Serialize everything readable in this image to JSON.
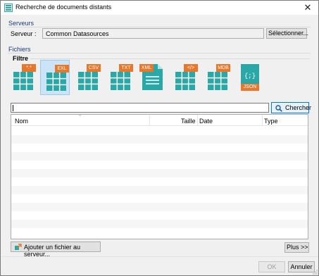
{
  "window": {
    "title": "Recherche de documents distants",
    "close_label": "✕"
  },
  "serveurs": {
    "group_title": "Serveurs",
    "server_label": "Serveur :",
    "server_value": "Common Datasources",
    "select_button": "Sélectionner..."
  },
  "fichiers": {
    "group_title": "Fichiers",
    "filter_label": "Filtre",
    "filters": [
      {
        "badge": "*.*",
        "kind": "table",
        "selected": false
      },
      {
        "badge": "EXL",
        "kind": "table",
        "selected": true
      },
      {
        "badge": "CSV",
        "kind": "table",
        "selected": false
      },
      {
        "badge": "TXT",
        "kind": "table",
        "selected": false
      },
      {
        "badge": "XML",
        "kind": "document",
        "selected": false
      },
      {
        "badge": "</>",
        "kind": "table",
        "selected": false
      },
      {
        "badge": "MDB",
        "kind": "table",
        "selected": false
      },
      {
        "badge": "JSON",
        "kind": "json",
        "selected": false
      }
    ],
    "search": {
      "value": "",
      "button_label": "Chercher"
    },
    "table": {
      "columns": [
        "Nom",
        "Taille",
        "Date",
        "Type"
      ],
      "rows": []
    },
    "add_file_button": "Ajouter un fichier au serveur...",
    "more_button": "Plus >>"
  },
  "footer": {
    "ok_button": "OK",
    "cancel_button": "Annuler"
  },
  "colors": {
    "accent": "#0078d7",
    "icon_teal": "#2aa8a8",
    "badge_orange": "#e8762b"
  }
}
